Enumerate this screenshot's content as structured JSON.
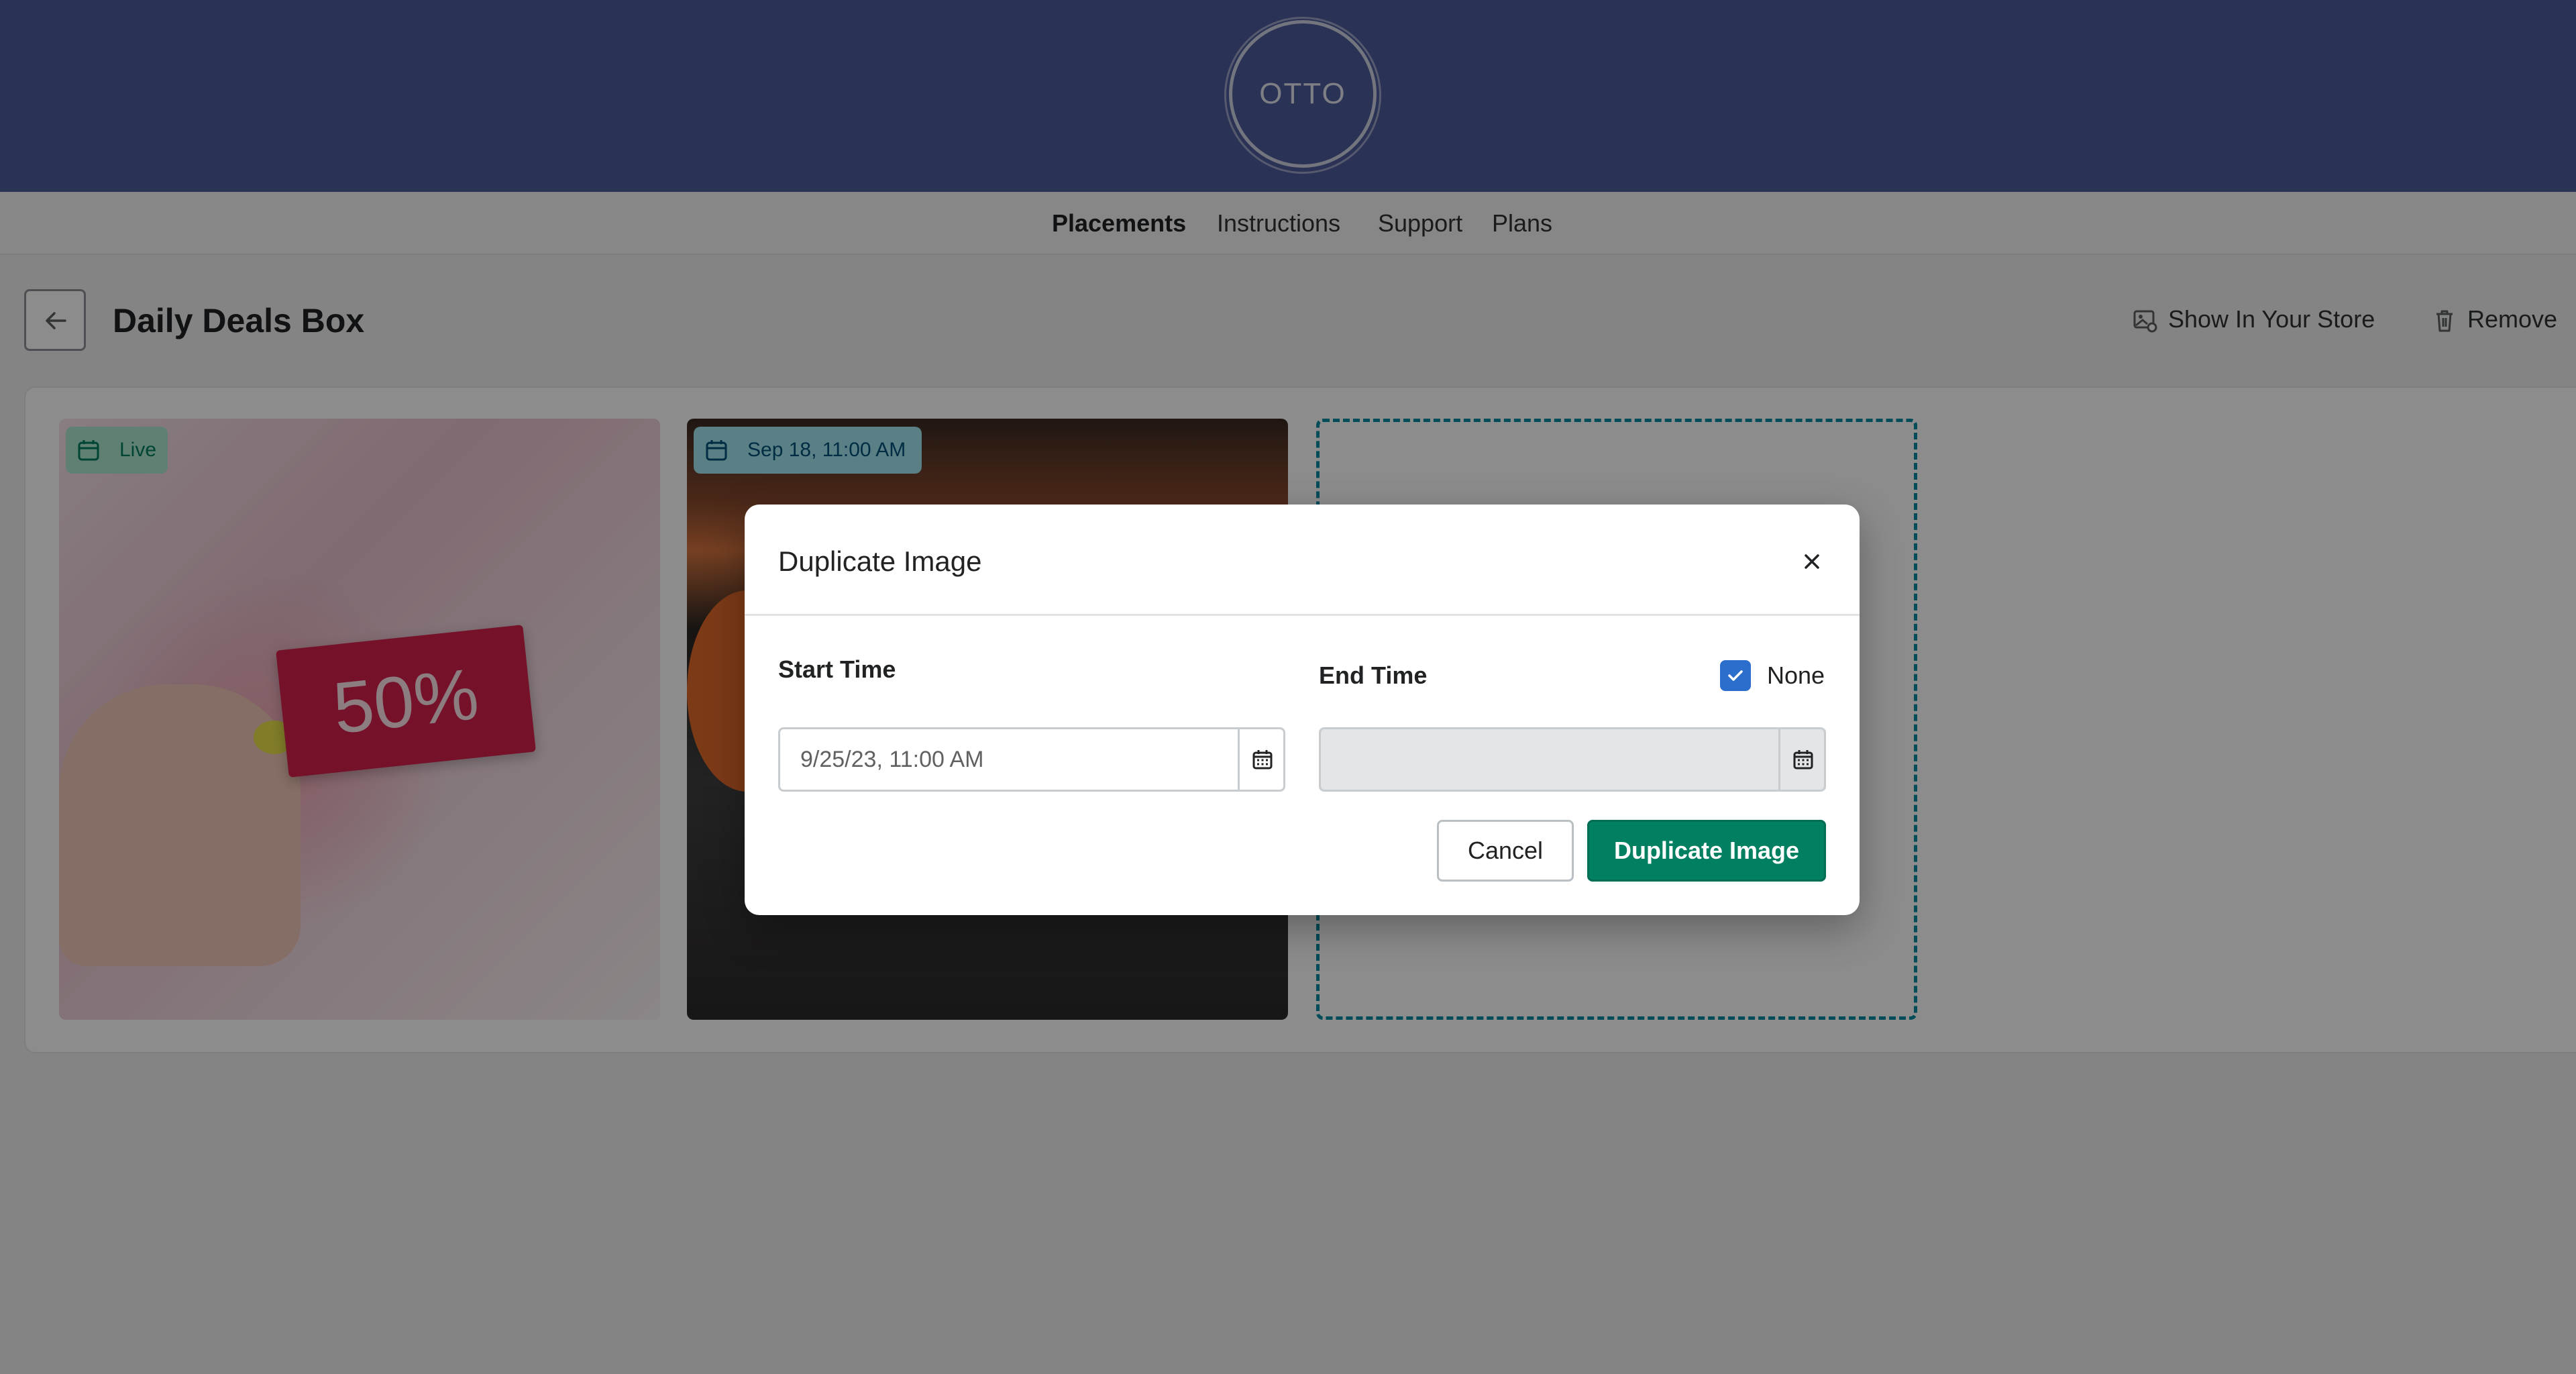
{
  "brand": {
    "logo_text": "OTTO"
  },
  "nav": {
    "items": [
      {
        "label": "Placements",
        "active": true
      },
      {
        "label": "Instructions",
        "active": false
      },
      {
        "label": "Support",
        "active": false
      },
      {
        "label": "Plans",
        "active": false
      }
    ]
  },
  "page": {
    "title": "Daily Deals Box",
    "actions": {
      "show_in_store": "Show In Your Store",
      "remove": "Remove"
    }
  },
  "images": [
    {
      "badge": "Live",
      "badge_icon": "calendar-icon",
      "graphic_text": "50%"
    },
    {
      "badge": "Sep 18, 11:00 AM",
      "badge_icon": "calendar-icon"
    }
  ],
  "modal": {
    "title": "Duplicate Image",
    "start_time": {
      "label": "Start Time",
      "value": "9/25/23, 11:00 AM"
    },
    "end_time": {
      "label": "End Time",
      "value": "",
      "none_label": "None",
      "none_checked": true
    },
    "cancel_label": "Cancel",
    "confirm_label": "Duplicate Image"
  },
  "colors": {
    "header_bg": "#4d5c9b",
    "primary": "#008060",
    "checkbox": "#2c6ecb",
    "dropzone_border": "#008ba3"
  }
}
